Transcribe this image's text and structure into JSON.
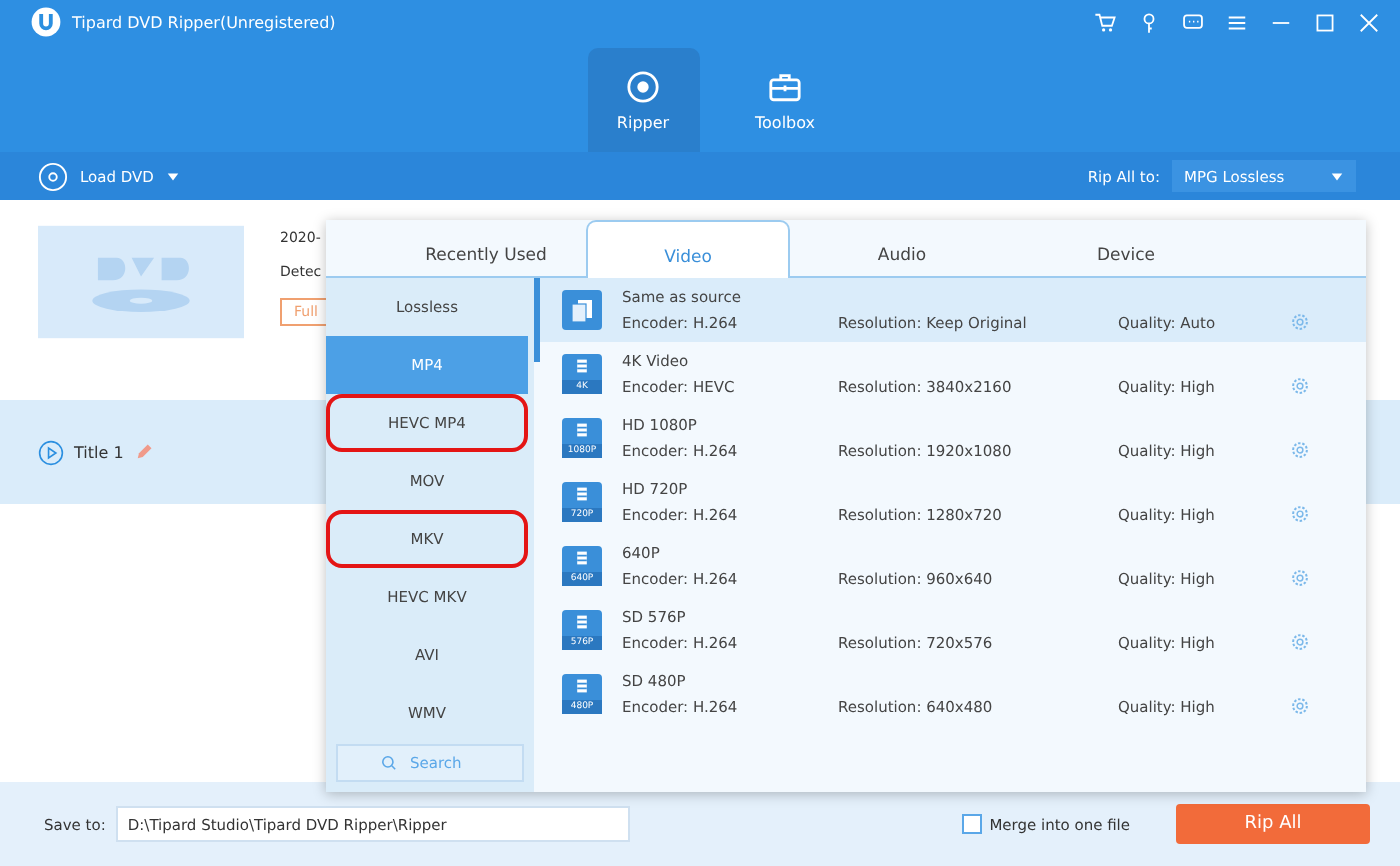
{
  "window": {
    "title": "Tipard DVD Ripper(Unregistered)"
  },
  "main_tabs": [
    {
      "label": "Ripper",
      "selected": true,
      "kind": "ripper"
    },
    {
      "label": "Toolbox",
      "selected": false,
      "kind": "toolbox"
    }
  ],
  "toolbar": {
    "load": "Load DVD",
    "rip_all_label": "Rip All to:",
    "rip_all_value": "MPG Lossless"
  },
  "disc": {
    "line_1": "2020-",
    "line_2": "Detec",
    "button": "Full"
  },
  "title_row": {
    "label": "Title 1"
  },
  "format_popup": {
    "tabs": [
      {
        "label": "Recently Used",
        "selected": false
      },
      {
        "label": "Video",
        "selected": true
      },
      {
        "label": "Audio",
        "selected": false
      },
      {
        "label": "Device",
        "selected": false
      }
    ],
    "formats": [
      {
        "label": "Lossless",
        "selected": false,
        "highlighted": false
      },
      {
        "label": "MP4",
        "selected": true,
        "highlighted": false
      },
      {
        "label": "HEVC MP4",
        "selected": false,
        "highlighted": true
      },
      {
        "label": "MOV",
        "selected": false,
        "highlighted": false
      },
      {
        "label": "MKV",
        "selected": false,
        "highlighted": true
      },
      {
        "label": "HEVC MKV",
        "selected": false,
        "highlighted": false
      },
      {
        "label": "AVI",
        "selected": false,
        "highlighted": false
      },
      {
        "label": "WMV",
        "selected": false,
        "highlighted": false
      }
    ],
    "search": {
      "placeholder": "Search"
    },
    "presets": [
      {
        "name": "Same as source",
        "encoder": "Encoder: H.264",
        "resolution": "Resolution: Keep Original",
        "quality": "Quality: Auto",
        "selected": true,
        "kind": "copy"
      },
      {
        "name": "4K Video",
        "badge": "4K",
        "encoder": "Encoder: HEVC",
        "resolution": "Resolution: 3840x2160",
        "quality": "Quality: High",
        "selected": false,
        "kind": "video"
      },
      {
        "name": "HD 1080P",
        "badge": "1080P",
        "encoder": "Encoder: H.264",
        "resolution": "Resolution: 1920x1080",
        "quality": "Quality: High",
        "selected": false,
        "kind": "video"
      },
      {
        "name": "HD 720P",
        "badge": "720P",
        "encoder": "Encoder: H.264",
        "resolution": "Resolution: 1280x720",
        "quality": "Quality: High",
        "selected": false,
        "kind": "video"
      },
      {
        "name": "640P",
        "badge": "640P",
        "encoder": "Encoder: H.264",
        "resolution": "Resolution: 960x640",
        "quality": "Quality: High",
        "selected": false,
        "kind": "video"
      },
      {
        "name": "SD 576P",
        "badge": "576P",
        "encoder": "Encoder: H.264",
        "resolution": "Resolution: 720x576",
        "quality": "Quality: High",
        "selected": false,
        "kind": "video"
      },
      {
        "name": "SD 480P",
        "badge": "480P",
        "encoder": "Encoder: H.264",
        "resolution": "Resolution: 640x480",
        "quality": "Quality: High",
        "selected": false,
        "kind": "video"
      }
    ]
  },
  "bottom_bar": {
    "save_label": "Save to:",
    "save_path": "D:\\Tipard Studio\\Tipard DVD Ripper\\Ripper",
    "merge": {
      "label": "Merge into one file",
      "checked": false
    },
    "rip_button": "Rip All"
  }
}
